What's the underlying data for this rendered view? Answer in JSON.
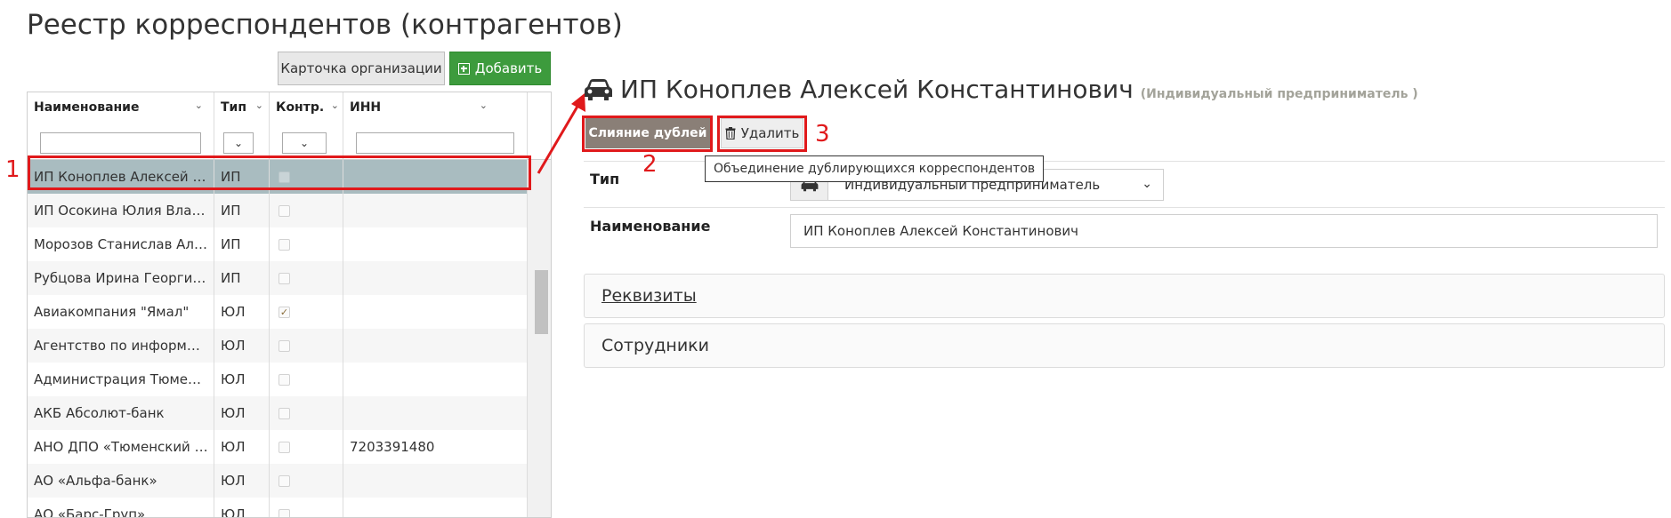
{
  "page": {
    "title": "Реестр корреспондентов (контрагентов)"
  },
  "toolbar": {
    "card_label": "Карточка организации",
    "add_label": "Добавить"
  },
  "grid": {
    "columns": {
      "name": "Наименование",
      "type": "Тип",
      "ctr": "Контр.",
      "inn": "ИНН"
    },
    "rows": [
      {
        "name": "ИП Коноплев Алексей Константинович",
        "type": "ИП",
        "ctr": false,
        "inn": ""
      },
      {
        "name": "ИП Осокина Юлия Владимировна",
        "type": "ИП",
        "ctr": false,
        "inn": ""
      },
      {
        "name": "Морозов Станислав Александрович",
        "type": "ИП",
        "ctr": false,
        "inn": ""
      },
      {
        "name": "Рубцова Ирина Георгиевна",
        "type": "ИП",
        "ctr": false,
        "inn": ""
      },
      {
        "name": "Авиакомпания \"Ямал\"",
        "type": "ЮЛ",
        "ctr": true,
        "inn": ""
      },
      {
        "name": "Агентство по информатизации",
        "type": "ЮЛ",
        "ctr": false,
        "inn": ""
      },
      {
        "name": "Администрация Тюменской области",
        "type": "ЮЛ",
        "ctr": false,
        "inn": ""
      },
      {
        "name": "АКБ Абсолют-банк",
        "type": "ЮЛ",
        "ctr": false,
        "inn": ""
      },
      {
        "name": "АНО ДПО «Тюменский институт»",
        "type": "ЮЛ",
        "ctr": false,
        "inn": "7203391480"
      },
      {
        "name": "АО «Альфа-банк»",
        "type": "ЮЛ",
        "ctr": false,
        "inn": ""
      },
      {
        "name": "АО «Барс-Груп»",
        "type": "ЮЛ",
        "ctr": false,
        "inn": ""
      }
    ]
  },
  "annotations": {
    "n1": "1",
    "n2": "2",
    "n3": "3"
  },
  "detail": {
    "name": "ИП Коноплев Алексей Константинович",
    "subtype": "(Индивидуальный предприниматель )",
    "merge_label": "Слияние дублей",
    "delete_label": "Удалить",
    "tooltip": "Объединение дублирующихся корреспондентов",
    "type_label": "Тип",
    "type_value": "Индивидуальный предприниматель",
    "name_label": "Наименование",
    "name_value": "ИП Коноплев Алексей Константинович",
    "panel_requisites": "Реквизиты",
    "panel_staff": "Сотрудники"
  },
  "colors": {
    "accent_green": "#3d9b3d",
    "annotation_red": "#e0191b",
    "selected_row": "#a9bcc0",
    "merge_button": "#8a7f77"
  },
  "icons": [
    "car-icon",
    "plus-icon",
    "trash-icon",
    "chevron-down-icon",
    "sort-icon",
    "checkbox-icon"
  ]
}
